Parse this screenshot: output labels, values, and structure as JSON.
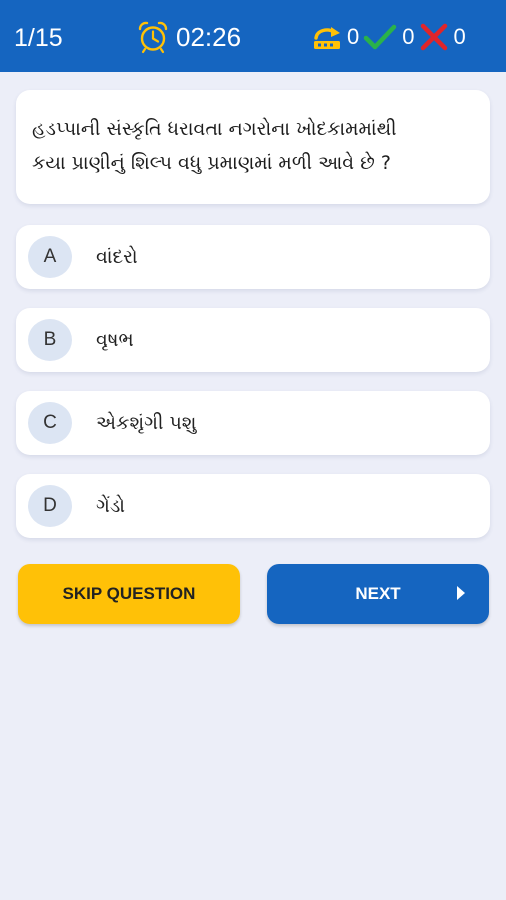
{
  "header": {
    "progress": "1/15",
    "timer": "02:26",
    "skipped_count": "0",
    "correct_count": "0",
    "wrong_count": "0"
  },
  "question": {
    "line1": "હડપ્પાની સંસ્કૃતિ ધરાવતા નગરોના ખોદકામમાંથી",
    "line2": "કયા પ્રાણીનું શિલ્પ વધુ પ્રમાણમાં મળી આવે છે ?"
  },
  "options": [
    {
      "letter": "A",
      "text": "વાંદરો"
    },
    {
      "letter": "B",
      "text": "વૃષભ"
    },
    {
      "letter": "C",
      "text": "એકશૃંગી પશુ"
    },
    {
      "letter": "D",
      "text": "ગેંડો"
    }
  ],
  "buttons": {
    "skip_label": "SKIP QUESTION",
    "next_label": "NEXT"
  },
  "colors": {
    "header_bg": "#1565c0",
    "skip_bg": "#ffc107",
    "next_bg": "#1565c0",
    "correct": "#2ab24a",
    "wrong": "#e0252a",
    "skipped_icon": "#ffc107",
    "page_bg": "#eceef8"
  },
  "icons": {
    "timer": "alarm-clock-icon",
    "skipped": "skip-arrow-icon",
    "correct": "check-icon",
    "wrong": "cross-icon",
    "next": "play-arrow-icon"
  }
}
